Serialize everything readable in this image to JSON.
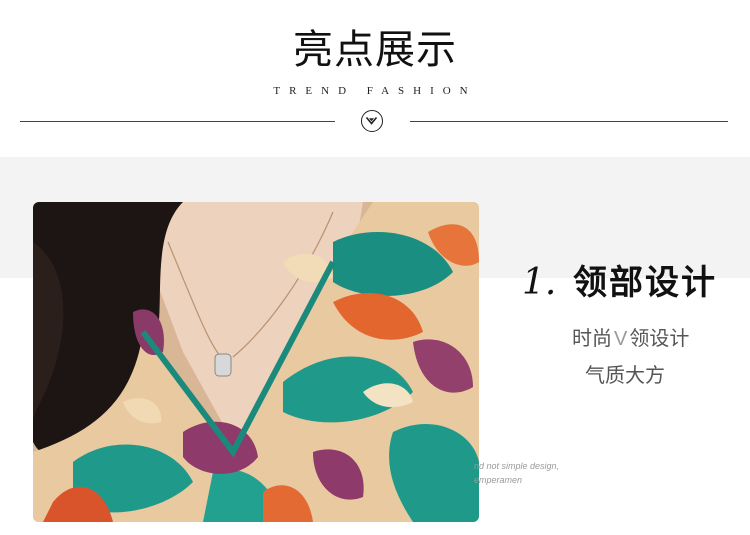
{
  "header": {
    "title": "亮点展示",
    "subtitle": "TREND FASHION"
  },
  "divider": {
    "icon": "chevron-down-circle-icon"
  },
  "feature": {
    "number": "1.",
    "title": "领部设计",
    "line1_before": "时尚",
    "line1_v": "V",
    "line1_after": "领设计",
    "line2": "气质大方"
  },
  "decorative_text": {
    "line1": "nd not simple design,",
    "line2": "emperamen"
  },
  "colors": {
    "background": "#ffffff",
    "band": "#f4f3f3",
    "text_dark": "#111111",
    "text_gray": "#555555"
  }
}
